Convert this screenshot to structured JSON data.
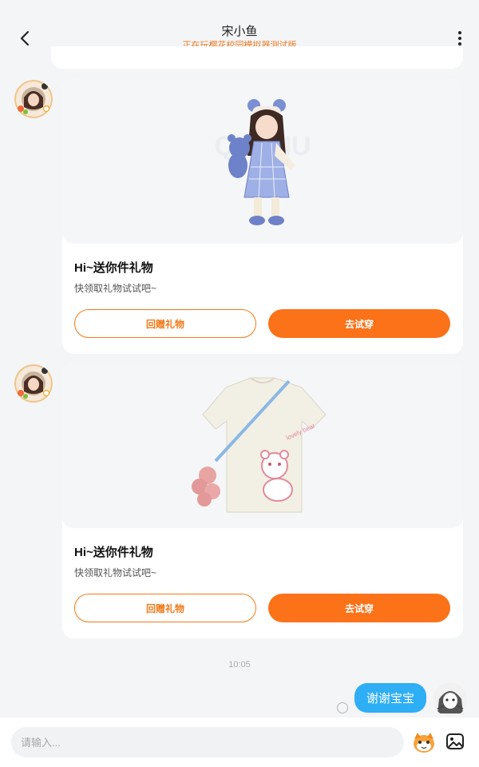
{
  "header": {
    "title": "宋小鱼",
    "subtitle": "正在玩樱花校园模拟器测试版"
  },
  "messages": [
    {
      "type": "gift",
      "image": "gift-outfit-1",
      "title": "Hi~送你件礼物",
      "subtitle": "快领取礼物试试吧~",
      "return_label": "回赠礼物",
      "try_label": "去试穿"
    },
    {
      "type": "gift",
      "image": "gift-outfit-2",
      "title": "Hi~送你件礼物",
      "subtitle": "快领取礼物试试吧~",
      "return_label": "回赠礼物",
      "try_label": "去试穿"
    }
  ],
  "timestamp": "10:05",
  "my_message": "谢谢宝宝",
  "input": {
    "placeholder": "请输入..."
  },
  "colors": {
    "accent": "#fb7219",
    "bubble": "#2eaef5",
    "subtitle": "#f07a21"
  },
  "icons": [
    "back-arrow-icon",
    "more-vertical-icon",
    "emoji-icon",
    "image-icon"
  ]
}
